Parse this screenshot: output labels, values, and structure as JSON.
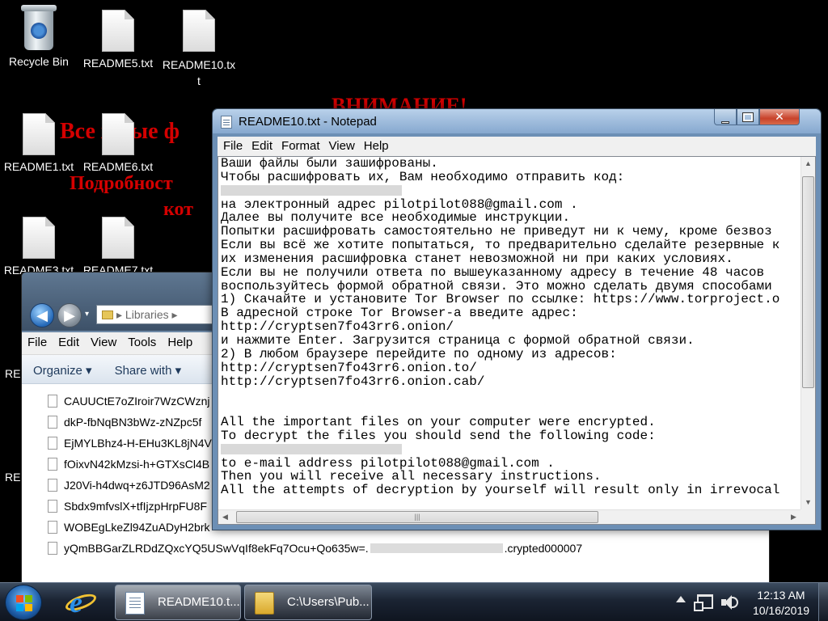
{
  "wallpaper": {
    "line1": "ВНИМАНИЕ!",
    "line2": "Все   жные ф",
    "line3": "Подробност",
    "line4": "кот"
  },
  "desktop_icons": [
    {
      "label": "Recycle Bin",
      "icon": "recycle-bin-icon"
    },
    {
      "label": "README5.txt",
      "icon": "text-file-icon"
    },
    {
      "label": "README10.txt",
      "icon": "text-file-icon"
    },
    {
      "label": "README1.txt",
      "icon": "text-file-icon"
    },
    {
      "label": "README6.txt",
      "icon": "text-file-icon"
    },
    {
      "label": "README3.txt",
      "icon": "text-file-icon"
    },
    {
      "label": "README7.txt",
      "icon": "text-file-icon"
    },
    {
      "label": "RE",
      "icon": "text-file-icon"
    },
    {
      "label": "RE",
      "icon": "text-file-icon"
    }
  ],
  "explorer": {
    "address": "Libraries",
    "menu": [
      "File",
      "Edit",
      "View",
      "Tools",
      "Help"
    ],
    "commands": {
      "organize": "Organize ▾",
      "share": "Share with ▾"
    },
    "files": [
      {
        "prefix": "CAUUCtE7oZIroir7WzCWznj",
        "suffix": ""
      },
      {
        "prefix": "dkP-fbNqBN3bWz-zNZpc5f",
        "suffix": ""
      },
      {
        "prefix": "EjMYLBhz4-H-EHu3KL8jN4V",
        "suffix": ""
      },
      {
        "prefix": "fOixvN42kMzsi-h+GTXsCl4B",
        "suffix": ""
      },
      {
        "prefix": "J20Vi-h4dwq+z6JTD96AsM2",
        "suffix": ""
      },
      {
        "prefix": "Sbdx9mfvslX+tfIjzpHrpFU8F",
        "suffix": ""
      },
      {
        "prefix": "WOBEgLkeZl94ZuADyH2brk",
        "suffix": ""
      },
      {
        "prefix": "yQmBBGarZLRDdZQxcYQ5USwVqIf8ekFq7Ocu+Qo635w=.",
        "suffix": ".crypted000007"
      }
    ]
  },
  "notepad": {
    "title": "README10.txt - Notepad",
    "menu": [
      "File",
      "Edit",
      "Format",
      "View",
      "Help"
    ],
    "controls": {
      "minimize": "minimize-icon",
      "maximize": "maximize-icon",
      "close": "close-icon"
    },
    "lines": [
      "Ваши файлы были зашифрованы.",
      "Чтобы расшифровать их, Вам необходимо отправить код:",
      "",
      "на электронный адрес pilotpilot088@gmail.com .",
      "Далее вы получите все необходимые инструкции.",
      "Попытки расшифровать самостоятельно не приведут ни к чему, кроме безвоз",
      "Если вы всё же хотите попытаться, то предварительно сделайте резервные к",
      "их изменения расшифровка станет невозможной ни при каких условиях.",
      "Если вы не получили ответа по вышеуказанному адресу в течение 48 часов ",
      "воспользуйтесь формой обратной связи. Это можно сделать двумя способами",
      "1) Скачайте и установите Tor Browser по ссылке: https://www.torproject.o",
      "В адресной строке Tor Browser-а введите адрес:",
      "http://cryptsen7fo43rr6.onion/",
      "и нажмите Enter. Загрузится страница с формой обратной связи.",
      "2) В любом браузере перейдите по одному из адресов:",
      "http://cryptsen7fo43rr6.onion.to/",
      "http://cryptsen7fo43rr6.onion.cab/",
      "",
      "",
      "All the important files on your computer were encrypted.",
      "To decrypt the files you should send the following code:",
      "",
      "to e-mail address pilotpilot088@gmail.com .",
      "Then you will receive all necessary instructions.",
      "All the attempts of decryption by yourself will result only in irrevocal"
    ],
    "redacted_lines": [
      2,
      21
    ]
  },
  "taskbar": {
    "tasks": [
      {
        "label": "README10.t...",
        "icon": "notepad-icon"
      },
      {
        "label": "C:\\Users\\Pub...",
        "icon": "folder-icon"
      }
    ],
    "clock": {
      "time": "12:13 AM",
      "date": "10/16/2019"
    }
  }
}
